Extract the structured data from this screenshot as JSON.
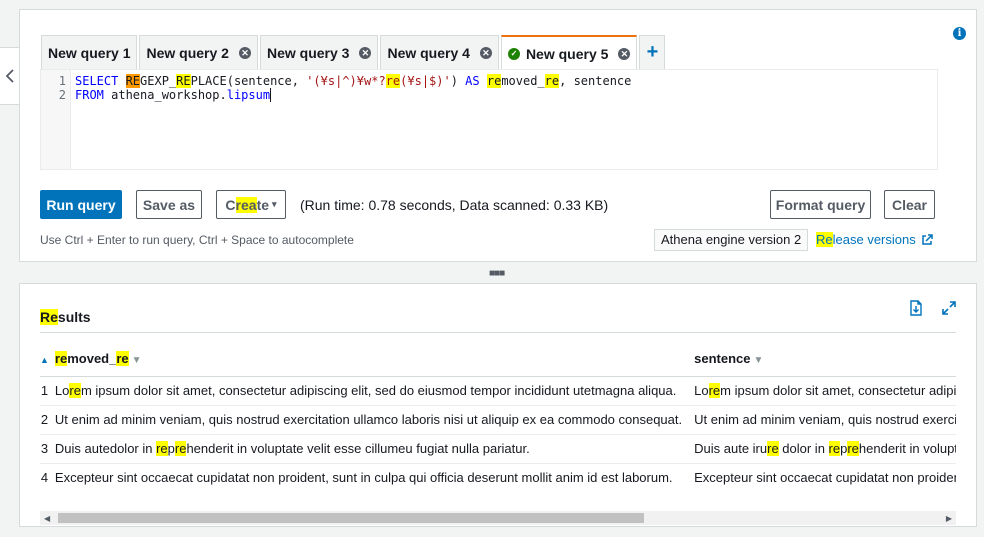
{
  "tabs": [
    {
      "label": "New query 1",
      "closable": false,
      "active": false
    },
    {
      "label": "New query 2",
      "closable": true,
      "active": false
    },
    {
      "label": "New query 3",
      "closable": true,
      "active": false
    },
    {
      "label": "New query 4",
      "closable": true,
      "active": false
    },
    {
      "label": "New query 5",
      "closable": true,
      "active": true,
      "status": "success"
    }
  ],
  "add_tab_label": "+",
  "info_label": "i",
  "editor": {
    "line_numbers": [
      "1",
      "2"
    ],
    "line1": {
      "select": "SELECT ",
      "fn_hl_o": "RE",
      "fn_a": "GEXP_",
      "fn_hl": "RE",
      "fn_b": "PLACE(sentence, ",
      "str_a": "'(¥s|^)¥w*?",
      "str_hl": "re",
      "str_b": "(¥s|$)'",
      "close": ") ",
      "as": "AS ",
      "alias_hl1": "re",
      "alias_mid": "moved_",
      "alias_hl2": "re",
      "rest": ", sentence"
    },
    "line2": {
      "from": "FROM ",
      "table": "athena_workshop.",
      "table2": "lipsum"
    }
  },
  "toolbar": {
    "run_query": "Run query",
    "save_as": "Save as",
    "create_pre": "C",
    "create_hl": "rea",
    "create_post": "te",
    "status": "(Run time: 0.78 seconds, Data scanned: 0.33 KB)",
    "format_query": "Format query",
    "clear": "Clear"
  },
  "hint": "Use Ctrl + Enter to run query, Ctrl + Space to autocomplete",
  "engine_version": "Athena engine version 2",
  "release_hl": "Re",
  "release_rest": "lease versions",
  "results": {
    "title_hl": "Re",
    "title_rest": "sults",
    "columns": [
      {
        "pre": "",
        "hl": "re",
        "mid": "moved_",
        "hl2": "re",
        "post": ""
      },
      {
        "pre": "sentence",
        "hl": "",
        "mid": "",
        "hl2": "",
        "post": ""
      }
    ],
    "rows": [
      {
        "n": "1",
        "c1_pre": "Lo",
        "c1_hl": "re",
        "c1_post": "m ipsum dolor sit amet, consectetur adipiscing elit, sed do eiusmod tempor incididunt utetmagna aliqua.",
        "c2_pre": "Lo",
        "c2_hl": "re",
        "c2_post": "m ipsum dolor sit amet, consectetur adipiscing elit"
      },
      {
        "n": "2",
        "c1_pre": "Ut enim ad minim veniam, quis nostrud exercitation ullamco laboris nisi ut aliquip ex ea commodo consequat.",
        "c1_hl": "",
        "c1_post": "",
        "c2_pre": "Ut enim ad minim veniam, quis nostrud exercitation",
        "c2_hl": "",
        "c2_post": ""
      },
      {
        "n": "3",
        "c1_pre": "Duis autedolor in ",
        "c1_hl": "re",
        "c1_mid": "p",
        "c1_hl2": "re",
        "c1_post": "henderit in voluptate velit esse cillumeu fugiat nulla pariatur.",
        "c2_pre": "Duis aute iru",
        "c2_hl": "re",
        "c2_mid": " dolor in ",
        "c2_hl2": "re",
        "c2_mid2": "p",
        "c2_hl3": "re",
        "c2_post": "henderit in voluptate"
      },
      {
        "n": "4",
        "c1_pre": "Excepteur sint occaecat cupidatat non proident, sunt in culpa qui officia deserunt mollit anim id est laborum.",
        "c1_hl": "",
        "c1_post": "",
        "c2_pre": "Excepteur sint occaecat cupidatat non proident, sunt",
        "c2_hl": "",
        "c2_post": ""
      }
    ]
  },
  "colors": {
    "accent": "#0073bb",
    "active_tab": "#ec7211",
    "success": "#1d8102",
    "highlight": "#ffff00",
    "highlight_alt": "#ff9900"
  }
}
